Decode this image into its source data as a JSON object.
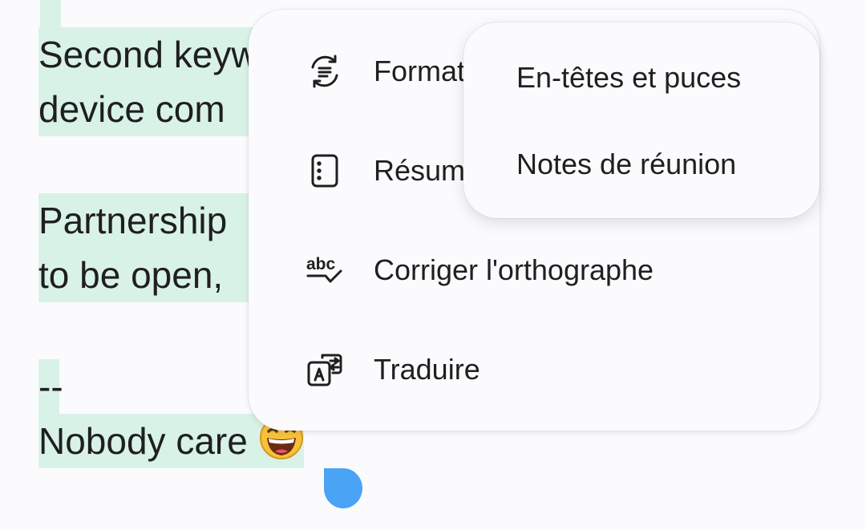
{
  "document": {
    "lines": [
      "Second keyw",
      "device com",
      "Partnership",
      "to be open,",
      "--",
      "Nobody care"
    ],
    "emoji": "grinning-face-with-sweat-emoji"
  },
  "menu": {
    "items": [
      {
        "label": "Format",
        "icon": "format-arrows-icon"
      },
      {
        "label": "Résumé",
        "icon": "summary-list-icon"
      },
      {
        "label": "Corriger l'orthographe",
        "icon": "spellcheck-icon"
      },
      {
        "label": "Traduire",
        "icon": "translate-icon"
      }
    ]
  },
  "submenu": {
    "items": [
      {
        "label": "En-têtes et puces"
      },
      {
        "label": "Notes de réunion"
      }
    ]
  },
  "colors": {
    "selection": "#d9f2e7",
    "handle": "#4aa3f5",
    "surface": "#fbfbfe"
  }
}
